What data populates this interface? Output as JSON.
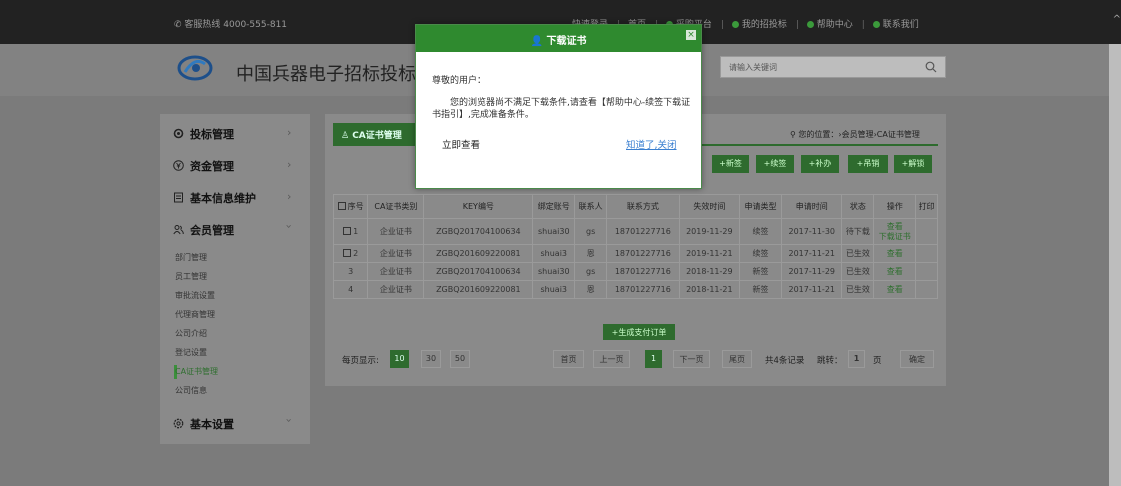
{
  "topbar": {
    "hotline": "客服热线 4000-555-811",
    "links": [
      "采购平台",
      "我的招投标",
      "帮助中心",
      "联系我们"
    ],
    "obscured_links": [
      "快速登录",
      "首页"
    ]
  },
  "header": {
    "site_name": "中国兵器电子招标投标交",
    "search_placeholder": "请输入关键词"
  },
  "sidebar": {
    "items": [
      {
        "label": "投标管理"
      },
      {
        "label": "资金管理"
      },
      {
        "label": "基本信息维护"
      },
      {
        "label": "会员管理"
      },
      {
        "label": "基本设置"
      }
    ],
    "sub_items": [
      "部门管理",
      "员工管理",
      "审批流设置",
      "代理商管理",
      "公司介绍",
      "登记设置",
      "CA证书管理",
      "公司信息"
    ],
    "active_sub": "CA证书管理"
  },
  "main": {
    "tab_label": "CA证书管理",
    "location": "您的位置：›会员管理›CA证书管理",
    "actions": [
      "+新签",
      "+续签",
      "+补办",
      "+吊销",
      "+解锁"
    ],
    "table": {
      "headers": [
        "序号",
        "CA证书类别",
        "KEY编号",
        "绑定账号",
        "联系人",
        "联系方式",
        "失效时间",
        "申请类型",
        "申请时间",
        "状态",
        "操作",
        "打印"
      ],
      "rows": [
        {
          "no": "1",
          "type": "企业证书",
          "key": "ZGBQ201704100634",
          "account": "shuai30",
          "contact": "gs",
          "phone": "18701227716",
          "expire": "2019-11-29",
          "apply_type": "续签",
          "apply_time": "2017-11-30",
          "status": "待下载",
          "op": [
            "查看",
            "下载证书"
          ],
          "print": ""
        },
        {
          "no": "2",
          "type": "企业证书",
          "key": "ZGBQ201609220081",
          "account": "shuai3",
          "contact": "恩",
          "phone": "18701227716",
          "expire": "2019-11-21",
          "apply_type": "续签",
          "apply_time": "2017-11-21",
          "status": "已生效",
          "op": [
            "查看"
          ],
          "print": ""
        },
        {
          "no": "3",
          "type": "企业证书",
          "key": "ZGBQ201704100634",
          "account": "shuai30",
          "contact": "gs",
          "phone": "18701227716",
          "expire": "2018-11-29",
          "apply_type": "新签",
          "apply_time": "2017-11-29",
          "status": "已生效",
          "op": [
            "查看"
          ],
          "print": ""
        },
        {
          "no": "4",
          "type": "企业证书",
          "key": "ZGBQ201609220081",
          "account": "shuai3",
          "contact": "恩",
          "phone": "18701227716",
          "expire": "2018-11-21",
          "apply_type": "新签",
          "apply_time": "2017-11-21",
          "status": "已生效",
          "op": [
            "查看"
          ],
          "print": ""
        }
      ]
    },
    "pay_button": "+生成支付订单",
    "pager": {
      "per_page_label": "每页显示:",
      "sizes": [
        "10",
        "30",
        "50"
      ],
      "first": "首页",
      "prev": "上一页",
      "current": "1",
      "next": "下一页",
      "last": "尾页",
      "total": "共4条记录",
      "jump_label": "跳转：",
      "jump_value": "1",
      "page_unit": "页",
      "confirm": "确定"
    }
  },
  "modal": {
    "title": "下载证书",
    "greeting": "尊敬的用户：",
    "message": "您的浏览器尚不满足下载条件,请查看【帮助中心-续签下载证书指引】,完成准备条件。",
    "view_now": "立即查看",
    "got_it_close": "知道了,关闭",
    "accent": "#2f8a2f"
  }
}
